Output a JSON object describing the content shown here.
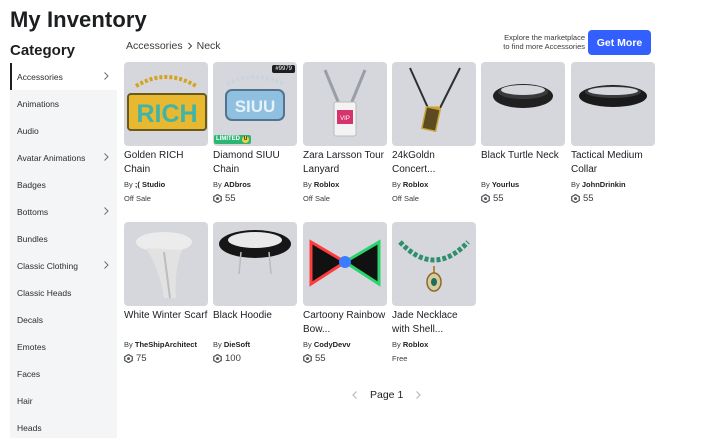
{
  "title": "My Inventory",
  "sidebar": {
    "heading": "Category",
    "items": [
      {
        "label": "Accessories",
        "chevron": true,
        "selected": true
      },
      {
        "label": "Animations",
        "chevron": false
      },
      {
        "label": "Audio",
        "chevron": false
      },
      {
        "label": "Avatar Animations",
        "chevron": true
      },
      {
        "label": "Badges",
        "chevron": false
      },
      {
        "label": "Bottoms",
        "chevron": true
      },
      {
        "label": "Bundles",
        "chevron": false
      },
      {
        "label": "Classic Clothing",
        "chevron": true
      },
      {
        "label": "Classic Heads",
        "chevron": false
      },
      {
        "label": "Decals",
        "chevron": false
      },
      {
        "label": "Emotes",
        "chevron": false
      },
      {
        "label": "Faces",
        "chevron": false
      },
      {
        "label": "Hair",
        "chevron": false
      },
      {
        "label": "Heads",
        "chevron": false
      }
    ]
  },
  "breadcrumb": {
    "parent": "Accessories",
    "current": "Neck"
  },
  "promo": {
    "line1": "Explore the marketplace",
    "line2": "to find more Accessories",
    "button": "Get More"
  },
  "items": [
    {
      "name": "Golden RICH Chain",
      "by": "By",
      "creator": "⁠;( Studio",
      "price": "Off Sale",
      "robux": false
    },
    {
      "name": "Diamond SIUU Chain",
      "by": "By",
      "creator": "ADbros",
      "price": "55",
      "robux": true,
      "limited": "LIMITED",
      "limited_u": "U",
      "serial": "#9979"
    },
    {
      "name": "Zara Larsson Tour Lanyard",
      "by": "By",
      "creator": "Roblox",
      "price": "Off Sale",
      "robux": false
    },
    {
      "name": "24kGoldn Concert...",
      "by": "By",
      "creator": "Roblox",
      "price": "Off Sale",
      "robux": false
    },
    {
      "name": "Black Turtle Neck",
      "by": "By",
      "creator": "Yourlus",
      "price": "55",
      "robux": true
    },
    {
      "name": "Tactical Medium Collar",
      "by": "By",
      "creator": "JohnDrinkin",
      "price": "55",
      "robux": true
    },
    {
      "name": "White Winter Scarf",
      "by": "By",
      "creator": "TheShipArchitect",
      "price": "75",
      "robux": true
    },
    {
      "name": "Black Hoodie",
      "by": "By",
      "creator": "DieSoft",
      "price": "100",
      "robux": true
    },
    {
      "name": "Cartoony Rainbow Bow...",
      "by": "By",
      "creator": "CodyDevv",
      "price": "55",
      "robux": true
    },
    {
      "name": "Jade Necklace with Shell...",
      "by": "By",
      "creator": "Roblox",
      "price": "Free",
      "robux": false
    }
  ],
  "pager": {
    "label": "Page 1"
  },
  "colors": {
    "accent": "#335fff",
    "thumb_bg": "#d5d7dd",
    "sidebar_bg": "#f4f5f6"
  },
  "icons": {
    "robux": "robux-icon",
    "chevron": "chevron-right-icon",
    "prev": "chevron-left-icon",
    "next": "chevron-right-icon"
  }
}
